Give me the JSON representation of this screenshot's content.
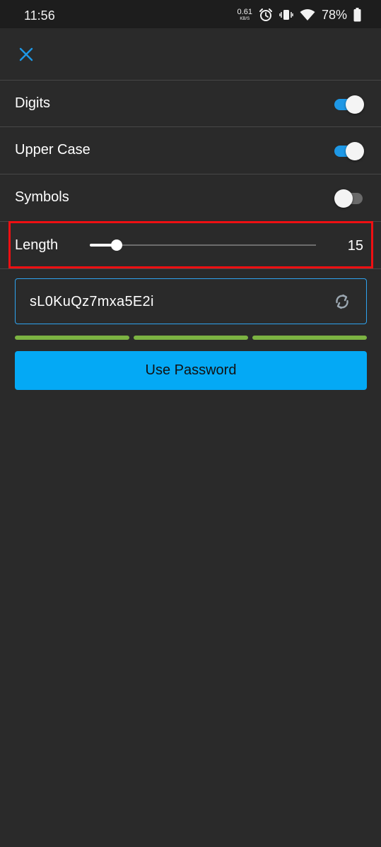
{
  "status_bar": {
    "time": "11:56",
    "net_speed_value": "0.61",
    "net_speed_unit": "KB/S",
    "battery_percent": "78%",
    "icons": [
      "alarm-icon",
      "vibrate-icon",
      "wifi-icon",
      "battery-icon"
    ]
  },
  "toolbar": {
    "close_icon": "close-icon"
  },
  "options": {
    "digits": {
      "label": "Digits",
      "enabled": true
    },
    "upper_case": {
      "label": "Upper Case",
      "enabled": true
    },
    "symbols": {
      "label": "Symbols",
      "enabled": false
    }
  },
  "length": {
    "label": "Length",
    "value": "15",
    "slider_fraction": 0.12
  },
  "password": {
    "value": "sL0KuQz7mxa5E2i",
    "refresh_icon": "refresh-icon"
  },
  "strength": {
    "segments": 3,
    "filled": 3,
    "color": "#7cb342"
  },
  "use_button": {
    "label": "Use Password"
  },
  "colors": {
    "accent": "#1e98e6",
    "button": "#04a9f5",
    "background": "#2a2a2a",
    "highlight": "#ee0f12"
  }
}
